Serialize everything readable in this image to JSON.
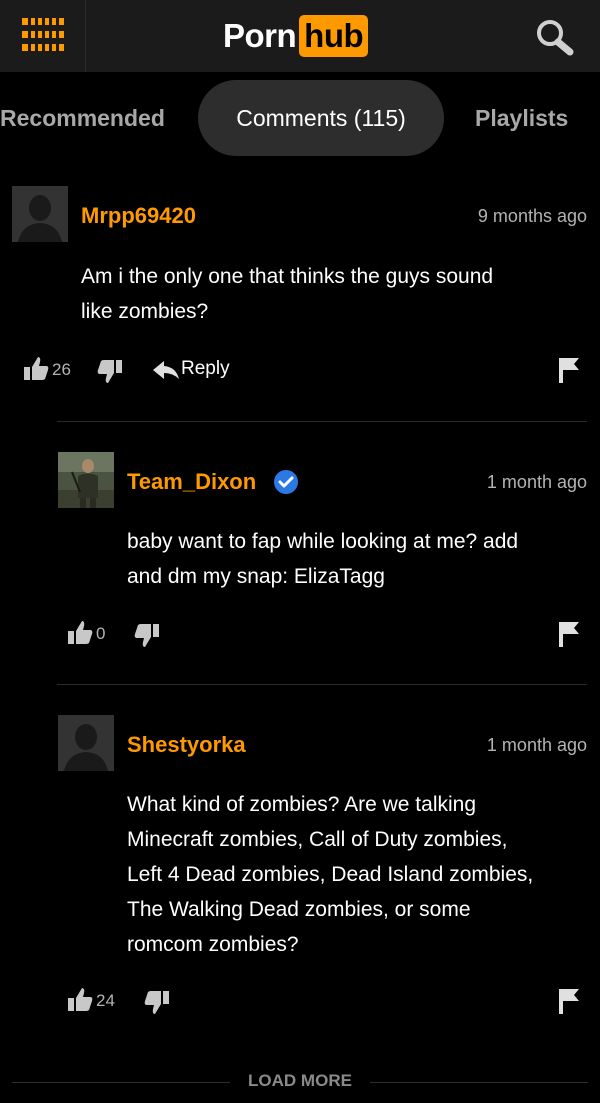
{
  "header": {
    "logo_part1": "Porn",
    "logo_part2": "hub",
    "brand_color": "#ff9900"
  },
  "tabs": [
    {
      "label": "Recommended",
      "active": false
    },
    {
      "label": "Comments (115)",
      "active": true
    },
    {
      "label": "Playlists",
      "active": false
    }
  ],
  "comments": [
    {
      "username": "Mrpp69420",
      "time": "9 months ago",
      "text_lines": [
        "Am i the only one that thinks the guys sound",
        "like zombies?"
      ],
      "likes": "26",
      "reply_label": "Reply",
      "avatar": "default-avatar-icon"
    },
    {
      "username": "Team_Dixon",
      "verified": true,
      "time": "1 month ago",
      "text_lines": [
        "baby want to fap while looking at me? add",
        "and dm my snap: ElizaTagg"
      ],
      "likes": "0",
      "avatar": "photo-avatar"
    },
    {
      "username": "Shestyorka",
      "time": "1 month ago",
      "text_lines": [
        "What kind of zombies? Are we talking",
        "Minecraft zombies, Call of Duty zombies,",
        "Left 4 Dead zombies, Dead Island zombies,",
        "The Walking Dead zombies, or some",
        "romcom zombies?"
      ],
      "likes": "24",
      "avatar": "default-avatar-icon"
    }
  ],
  "load_more": "LOAD MORE"
}
